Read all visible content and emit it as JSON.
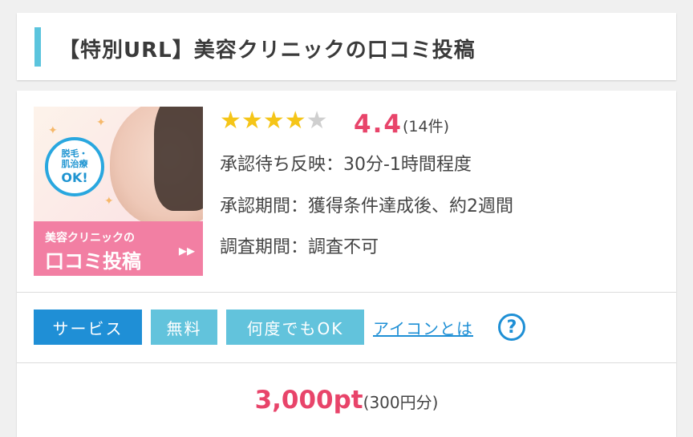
{
  "header": {
    "title": "【特別URL】美容クリニックの口コミ投稿"
  },
  "thumbnail": {
    "bubble_line1": "脱毛・",
    "bubble_line2": "肌治療",
    "bubble_line3": "OK!",
    "banner_line1": "美容クリニックの",
    "banner_line2": "口コミ投稿",
    "banner_arrow": "▸▸"
  },
  "rating": {
    "stars_filled": 4,
    "stars_total": 5,
    "value": "4.4",
    "count": "(14件)"
  },
  "info": {
    "approval_wait": "承認待ち反映：30分-1時間程度",
    "approval_period": "承認期間：獲得条件達成後、約2週間",
    "survey_period": "調査期間：調査不可"
  },
  "tags": {
    "service": "サービス",
    "free": "無料",
    "many_times": "何度でもOK",
    "icon_link": "アイコンとは",
    "help_icon": "?"
  },
  "reward": {
    "points": "3,000pt",
    "yen": "(300円分)"
  },
  "colors": {
    "accent_bar": "#5bc4dd",
    "star": "#f5c518",
    "rating_red": "#e8446a",
    "tag_service": "#1f8fd6",
    "tag_light": "#62c3dc",
    "link": "#1e8fd5"
  }
}
